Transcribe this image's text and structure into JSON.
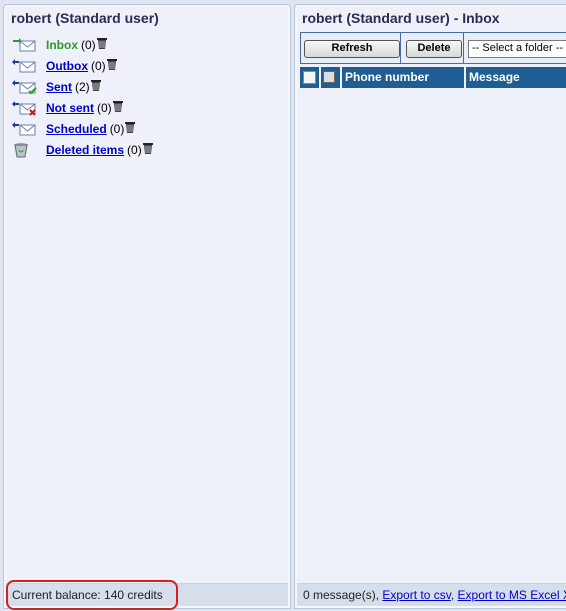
{
  "left_panel": {
    "title": "robert (Standard user)",
    "folders": [
      {
        "name": "inbox",
        "label": "Inbox",
        "count": "(0)",
        "icon": "mail-in-icon",
        "active": true
      },
      {
        "name": "outbox",
        "label": "Outbox",
        "count": "(0)",
        "icon": "mail-out-icon"
      },
      {
        "name": "sent",
        "label": "Sent",
        "count": "(2)",
        "icon": "mail-sent-icon"
      },
      {
        "name": "not-sent",
        "label": "Not sent",
        "count": "(0)",
        "icon": "mail-failed-icon"
      },
      {
        "name": "scheduled",
        "label": "Scheduled",
        "count": "(0)",
        "icon": "mail-scheduled-icon"
      },
      {
        "name": "deleted-items",
        "label": "Deleted items",
        "count": "(0)",
        "icon": "recycle-bin-icon"
      }
    ],
    "status": "Current balance: 140 credits"
  },
  "right_panel": {
    "title": "robert (Standard user) - Inbox",
    "toolbar": {
      "refresh_label": "Refresh",
      "delete_label": "Delete",
      "folder_select": "-- Select a folder --"
    },
    "columns": [
      "Phone number",
      "Message"
    ],
    "status_count": "0 message(s),",
    "export_csv": "Export to csv",
    "separator": ",",
    "export_excel": "Export to MS Excel X"
  },
  "colors": {
    "header_blue": "#1f5d93",
    "active_green": "#2a9a2a",
    "link_blue": "#0000cc",
    "highlight_red": "#d42020"
  }
}
